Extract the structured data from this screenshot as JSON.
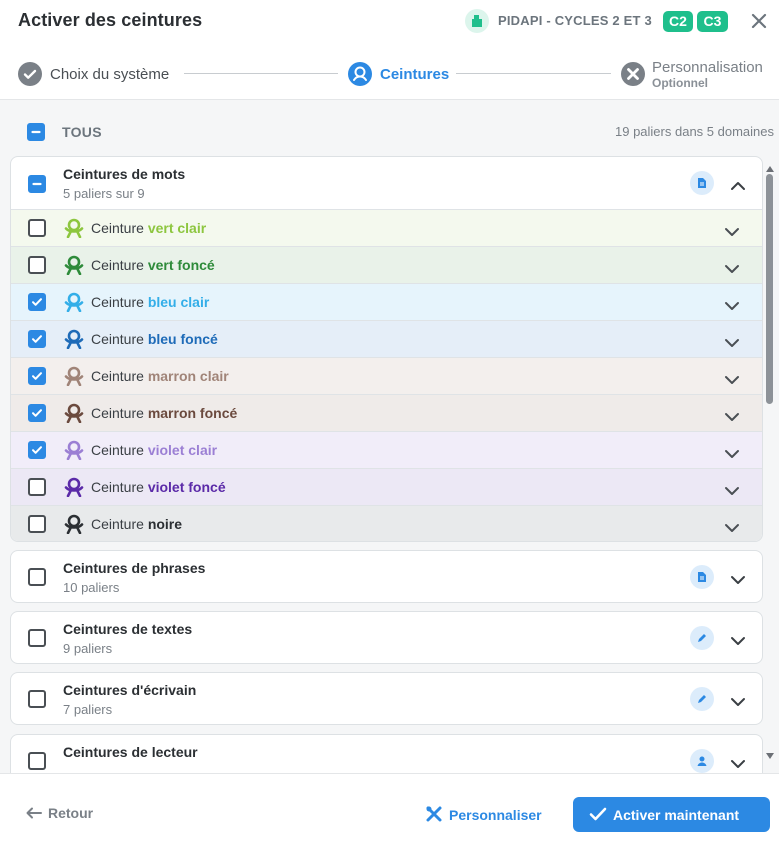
{
  "header": {
    "title": "Activer des ceintures",
    "system_name": "PIDAPI - CYCLES 2 ET 3",
    "cycles": [
      "C2",
      "C3"
    ],
    "accent": "#1fbf8c"
  },
  "stepper": {
    "steps": [
      {
        "label": "Choix du système",
        "state": "done"
      },
      {
        "label": "Ceintures",
        "state": "active"
      },
      {
        "label": "Personnalisation",
        "sublabel": "Optionnel",
        "state": "optional"
      }
    ]
  },
  "select_all": {
    "label": "TOUS",
    "summary": "19 paliers dans 5 domaines",
    "state": "partial"
  },
  "domains": [
    {
      "title": "Ceintures de mots",
      "subtitle": "5 paliers sur 9",
      "state": "partial",
      "icon": "document-icon",
      "expanded": true,
      "belts": [
        {
          "prefix": "Ceinture",
          "color_name": "vert clair",
          "color": "#8dc63f",
          "bg": "#f4f9ee",
          "checked": false
        },
        {
          "prefix": "Ceinture",
          "color_name": "vert foncé",
          "color": "#2e8b3a",
          "bg": "#e9f2e9",
          "checked": false
        },
        {
          "prefix": "Ceinture",
          "color_name": "bleu clair",
          "color": "#33aee8",
          "bg": "#e6f4fc",
          "checked": true
        },
        {
          "prefix": "Ceinture",
          "color_name": "bleu foncé",
          "color": "#1e6bb8",
          "bg": "#e5eef8",
          "checked": true
        },
        {
          "prefix": "Ceinture",
          "color_name": "marron clair",
          "color": "#a08478",
          "bg": "#f3efed",
          "checked": true
        },
        {
          "prefix": "Ceinture",
          "color_name": "marron foncé",
          "color": "#6b4a3e",
          "bg": "#efebe9",
          "checked": true
        },
        {
          "prefix": "Ceinture",
          "color_name": "violet clair",
          "color": "#9b7fd4",
          "bg": "#f1edf9",
          "checked": true
        },
        {
          "prefix": "Ceinture",
          "color_name": "violet foncé",
          "color": "#5b2aa8",
          "bg": "#ece8f5",
          "checked": false
        },
        {
          "prefix": "Ceinture",
          "color_name": "noire",
          "color": "#2b2f33",
          "bg": "#e8eaeb",
          "checked": false
        }
      ]
    },
    {
      "title": "Ceintures de phrases",
      "subtitle": "10 paliers",
      "state": "unchecked",
      "icon": "document-icon",
      "expanded": false
    },
    {
      "title": "Ceintures de textes",
      "subtitle": "9 paliers",
      "state": "unchecked",
      "icon": "pen-icon",
      "expanded": false
    },
    {
      "title": "Ceintures d'écrivain",
      "subtitle": "7 paliers",
      "state": "unchecked",
      "icon": "pen-icon",
      "expanded": false
    },
    {
      "title": "Ceintures de lecteur",
      "subtitle": "",
      "state": "unchecked",
      "icon": "reader-icon",
      "expanded": false
    }
  ],
  "footer": {
    "back_label": "Retour",
    "customize_label": "Personnaliser",
    "activate_label": "Activer maintenant",
    "primary_color": "#2c89e3"
  }
}
